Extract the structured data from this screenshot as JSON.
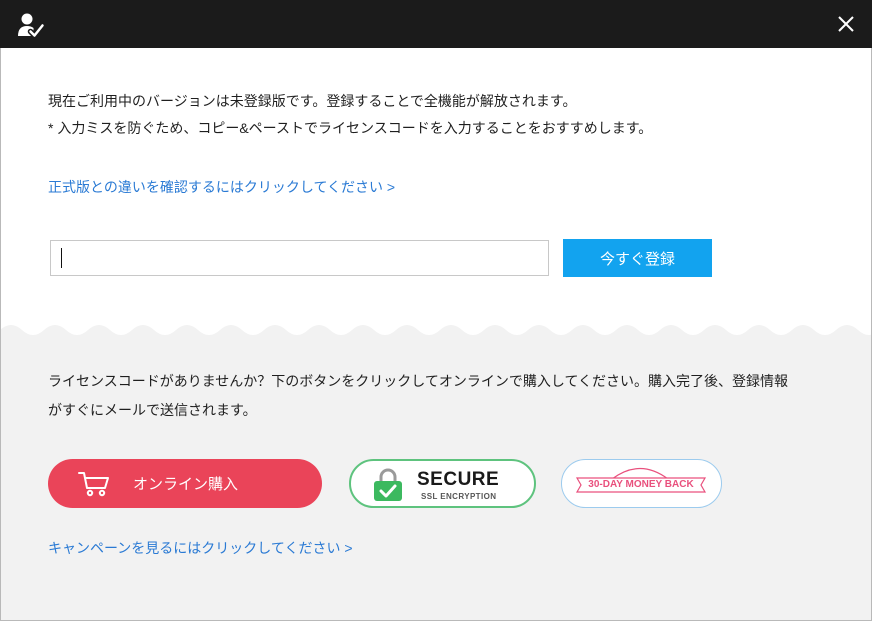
{
  "titlebar": {
    "icon": "user-check-icon",
    "close_icon": "close-icon"
  },
  "registration": {
    "notice_line1": "現在ご利用中のバージョンは未登録版です。登録することで全機能が解放されます。",
    "notice_line2": "* 入力ミスを防ぐため、コピー&ペーストでライセンスコードを入力することをおすすめします。",
    "compare_link": "正式版との違いを確認するにはクリックしてください >",
    "license_input": {
      "value": ""
    },
    "register_button": "今すぐ登録"
  },
  "purchase": {
    "text_line1": "ライセンスコードがありませんか？下のボタンをクリックしてオンラインで購入してください。購入完了後、登録情報",
    "text_line2": "がすぐにメールで送信されます。",
    "buy_button": {
      "label": "オンライン購入",
      "icon": "cart-icon"
    },
    "secure_badge": {
      "title": "SECURE",
      "subtitle": "SSL ENCRYPTION",
      "icon": "lock-check-icon"
    },
    "moneyback_badge": {
      "label": "30-DAY MONEY BACK"
    },
    "campaign_link": "キャンペーンを見るにはクリックしてください >"
  },
  "colors": {
    "titlebar_bg": "#1b1b1b",
    "link": "#2a7ad4",
    "register_button": "#12a3ef",
    "buy_button": "#ea4459",
    "secure_border": "#5ec37e",
    "lock_green": "#3cb95f",
    "moneyback_border": "#9ccbee",
    "moneyback_pink": "#e9507d",
    "purchase_bg": "#f2f2f2"
  }
}
